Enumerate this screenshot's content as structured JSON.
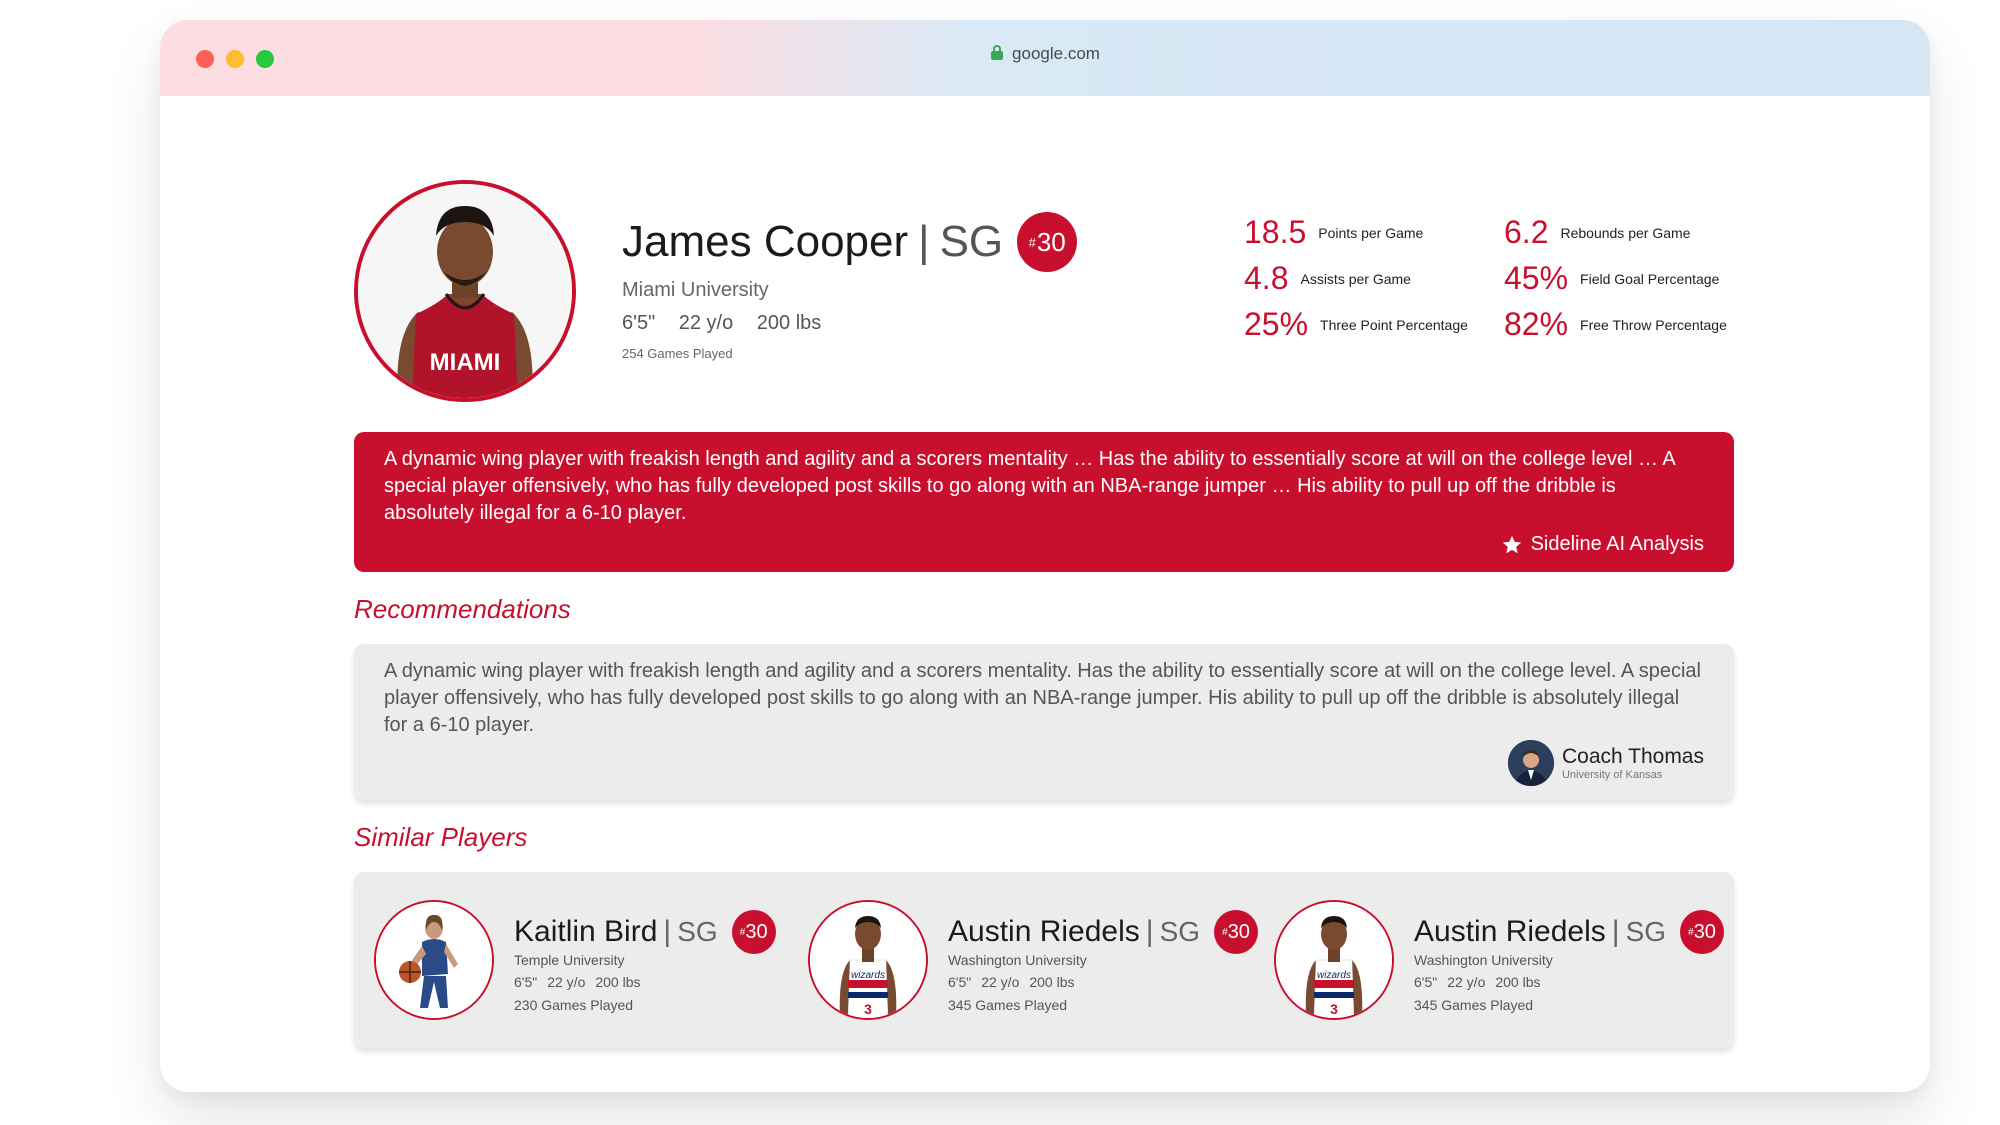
{
  "browser": {
    "url": "google.com"
  },
  "player": {
    "name": "James Cooper",
    "position": "SG",
    "number_prefix": "#",
    "number": "30",
    "school": "Miami University",
    "height": "6'5\"",
    "age": "22 y/o",
    "weight": "200 lbs",
    "games": "254 Games Played",
    "jersey_text": "MIAMI"
  },
  "stats": [
    {
      "value": "18.5",
      "label": "Points per Game"
    },
    {
      "value": "6.2",
      "label": "Rebounds per Game"
    },
    {
      "value": "4.8",
      "label": "Assists per Game"
    },
    {
      "value": "45%",
      "label": "Field Goal Percentage"
    },
    {
      "value": "25%",
      "label": "Three Point Percentage"
    },
    {
      "value": "82%",
      "label": "Free Throw Percentage"
    }
  ],
  "analysis": {
    "text": "A dynamic wing player with freakish length and agility and a scorers mentality … Has the ability to essentially score at will on the college level … A special player offensively, who has fully developed post skills to go along with an NBA-range jumper … His ability to pull up off the dribble is absolutely illegal for a 6-10 player.",
    "tag": "Sideline AI Analysis"
  },
  "recommendations": {
    "title": "Recommendations",
    "text": "A dynamic wing player with freakish length and agility and a scorers mentality. Has the ability to essentially score at will on the college level. A special player offensively, who has fully developed post skills to go along with an NBA-range jumper. His ability to pull up off the dribble is absolutely illegal for a 6-10 player.",
    "coach_name": "Coach Thomas",
    "coach_school": "University of Kansas"
  },
  "similar": {
    "title": "Similar Players",
    "players": [
      {
        "name": "Kaitlin Bird",
        "position": "SG",
        "number": "30",
        "school": "Temple University",
        "height": "6'5\"",
        "age": "22 y/o",
        "weight": "200 lbs",
        "games": "230 Games Played"
      },
      {
        "name": "Austin Riedels",
        "position": "SG",
        "number": "30",
        "school": "Washington University",
        "height": "6'5\"",
        "age": "22 y/o",
        "weight": "200 lbs",
        "games": "345 Games Played"
      },
      {
        "name": "Austin Riedels",
        "position": "SG",
        "number": "30",
        "school": "Washington University",
        "height": "6'5\"",
        "age": "22 y/o",
        "weight": "200 lbs",
        "games": "345 Games Played"
      }
    ]
  },
  "colors": {
    "accent": "#c8102e",
    "panel": "#ececec"
  }
}
